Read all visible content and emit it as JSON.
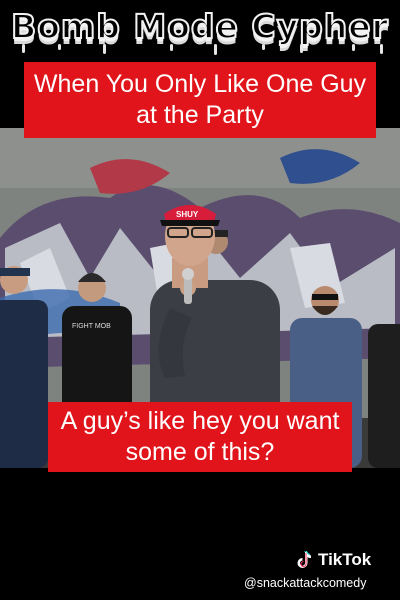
{
  "header": {
    "title": "Bomb Mode Cypher"
  },
  "captions": {
    "top": "When You Only Like One Guy at the Party",
    "bottom": "A guy’s like hey you want some of this?"
  },
  "watermark": {
    "brand": "TikTok",
    "handle": "@snackattackcomedy",
    "icon": "tiktok-note-icon"
  },
  "colors": {
    "caption_bg": "#e0141a",
    "background": "#000000"
  },
  "video": {
    "cap_text": "SHUY"
  }
}
